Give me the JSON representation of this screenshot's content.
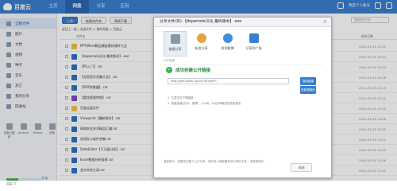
{
  "app": {
    "name": "百度云"
  },
  "nav": [
    {
      "label": "主页",
      "active": false
    },
    {
      "label": "网盘",
      "active": true
    },
    {
      "label": "分享",
      "active": false
    },
    {
      "label": "应用",
      "active": false
    }
  ],
  "user": {
    "name": "我是个人账号"
  },
  "sidebar": {
    "items": [
      {
        "label": "全部文件",
        "active": true
      },
      {
        "label": "图片",
        "active": false
      },
      {
        "label": "文档",
        "active": false
      },
      {
        "label": "视频",
        "active": false
      },
      {
        "label": "种子",
        "active": false
      },
      {
        "label": "音乐",
        "active": false
      },
      {
        "label": "其它",
        "active": false
      },
      {
        "label": "我的分享",
        "active": false
      },
      {
        "label": "回收站",
        "active": false
      }
    ],
    "devices": [
      "百度云管家",
      "Android",
      "iPhone",
      "其他"
    ],
    "quota": {
      "fraction": 0.35,
      "text": "容量 2T",
      "button": "扩容"
    }
  },
  "toolbar": {
    "upload": "上传",
    "new_folder": "新建文件夹",
    "offline": "离线下载",
    "search_placeholder": "搜索您的文件"
  },
  "breadcrumb": "返回上一级 | 全部文件 > 我的网盘 > 百度云",
  "list_header": {
    "name": "文件名",
    "size": "大小",
    "date": "修改日期"
  },
  "files": [
    {
      "name": "PPT/Word精品模板素材课件大全",
      "type": "folder",
      "date": "2014-01-05 13:22"
    },
    {
      "name": "【dopemole汉化 最终版本】.exe",
      "type": "doc",
      "date": "2014-01-05 13:22"
    },
    {
      "name": "【PS入门】.rar",
      "type": "doc",
      "date": "2014-01-05 13:20"
    },
    {
      "name": "【无损音乐合集大全】.rar",
      "type": "doc",
      "date": "2014-01-05 13:18"
    },
    {
      "name": "【PDF转换器】.rar",
      "type": "doc",
      "date": "2014-01-05 13:15"
    },
    {
      "name": "【超炫视频特效】.rar",
      "type": "vid",
      "date": "2014-01-05 13:12"
    },
    {
      "name": "百度云盘文件",
      "type": "folder",
      "date": "2014-01-05 13:10"
    },
    {
      "name": "Viewpoint【最新版本】.rar",
      "type": "doc",
      "date": "2014-01-05 13:08"
    },
    {
      "name": "网络安全技术精品汇编.rar",
      "type": "doc",
      "date": "2014-01-05 13:05"
    },
    {
      "name": "实用办公软件合集.rar",
      "type": "doc",
      "date": "2014-01-05 13:02"
    },
    {
      "name": "DataEditor【千万级分析】.rar",
      "type": "doc",
      "date": "2014-01-05 13:00"
    },
    {
      "name": "Excel数据分析报表.rar",
      "type": "doc",
      "date": "2014-01-05 12:58"
    },
    {
      "name": "会计实务工具.rar",
      "type": "doc",
      "date": "2014-01-05 12:55"
    }
  ],
  "modal": {
    "title": "分享文件(夹):【dopemole汉化 最终版本】.exe",
    "close": "×",
    "tabs": [
      {
        "label": "链接分享",
        "icon": "link-icon",
        "active": true
      },
      {
        "label": "私信分享",
        "icon": "private-message-icon",
        "active": false
      },
      {
        "label": "发到微博",
        "icon": "weibo-icon",
        "active": false
      },
      {
        "label": "分享到广场",
        "icon": "square-icon",
        "active": false
      }
    ],
    "section_label": "公开链接",
    "success_text": "成功创建公开链接",
    "link_value": "http://pan.baidu.com/s/1bnhtxP3",
    "copy_button": "复制链接",
    "copy_button2": "复制提取码",
    "note1": "1. 生成文件下载链接",
    "note2": "2. 把链接通过QQ、微博、人人网、QQ空间等发给您的朋友",
    "footer_note": "温馨提示：如果您创建了公开分享，则所有人都能看到您分享的文件，请谨慎操作。",
    "close_button": "关闭"
  }
}
